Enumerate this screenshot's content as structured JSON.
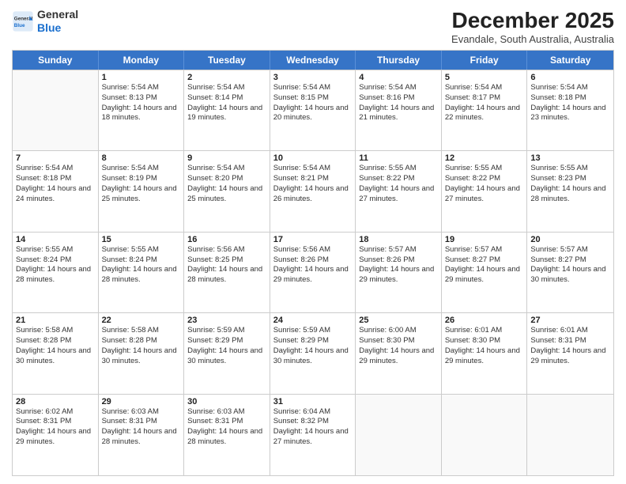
{
  "header": {
    "logo": {
      "general": "General",
      "blue": "Blue"
    },
    "title": "December 2025",
    "location": "Evandale, South Australia, Australia"
  },
  "weekdays": [
    "Sunday",
    "Monday",
    "Tuesday",
    "Wednesday",
    "Thursday",
    "Friday",
    "Saturday"
  ],
  "weeks": [
    [
      {
        "day": "",
        "sunrise": "",
        "sunset": "",
        "daylight": ""
      },
      {
        "day": "1",
        "sunrise": "Sunrise: 5:54 AM",
        "sunset": "Sunset: 8:13 PM",
        "daylight": "Daylight: 14 hours and 18 minutes."
      },
      {
        "day": "2",
        "sunrise": "Sunrise: 5:54 AM",
        "sunset": "Sunset: 8:14 PM",
        "daylight": "Daylight: 14 hours and 19 minutes."
      },
      {
        "day": "3",
        "sunrise": "Sunrise: 5:54 AM",
        "sunset": "Sunset: 8:15 PM",
        "daylight": "Daylight: 14 hours and 20 minutes."
      },
      {
        "day": "4",
        "sunrise": "Sunrise: 5:54 AM",
        "sunset": "Sunset: 8:16 PM",
        "daylight": "Daylight: 14 hours and 21 minutes."
      },
      {
        "day": "5",
        "sunrise": "Sunrise: 5:54 AM",
        "sunset": "Sunset: 8:17 PM",
        "daylight": "Daylight: 14 hours and 22 minutes."
      },
      {
        "day": "6",
        "sunrise": "Sunrise: 5:54 AM",
        "sunset": "Sunset: 8:18 PM",
        "daylight": "Daylight: 14 hours and 23 minutes."
      }
    ],
    [
      {
        "day": "7",
        "sunrise": "Sunrise: 5:54 AM",
        "sunset": "Sunset: 8:18 PM",
        "daylight": "Daylight: 14 hours and 24 minutes."
      },
      {
        "day": "8",
        "sunrise": "Sunrise: 5:54 AM",
        "sunset": "Sunset: 8:19 PM",
        "daylight": "Daylight: 14 hours and 25 minutes."
      },
      {
        "day": "9",
        "sunrise": "Sunrise: 5:54 AM",
        "sunset": "Sunset: 8:20 PM",
        "daylight": "Daylight: 14 hours and 25 minutes."
      },
      {
        "day": "10",
        "sunrise": "Sunrise: 5:54 AM",
        "sunset": "Sunset: 8:21 PM",
        "daylight": "Daylight: 14 hours and 26 minutes."
      },
      {
        "day": "11",
        "sunrise": "Sunrise: 5:55 AM",
        "sunset": "Sunset: 8:22 PM",
        "daylight": "Daylight: 14 hours and 27 minutes."
      },
      {
        "day": "12",
        "sunrise": "Sunrise: 5:55 AM",
        "sunset": "Sunset: 8:22 PM",
        "daylight": "Daylight: 14 hours and 27 minutes."
      },
      {
        "day": "13",
        "sunrise": "Sunrise: 5:55 AM",
        "sunset": "Sunset: 8:23 PM",
        "daylight": "Daylight: 14 hours and 28 minutes."
      }
    ],
    [
      {
        "day": "14",
        "sunrise": "Sunrise: 5:55 AM",
        "sunset": "Sunset: 8:24 PM",
        "daylight": "Daylight: 14 hours and 28 minutes."
      },
      {
        "day": "15",
        "sunrise": "Sunrise: 5:55 AM",
        "sunset": "Sunset: 8:24 PM",
        "daylight": "Daylight: 14 hours and 28 minutes."
      },
      {
        "day": "16",
        "sunrise": "Sunrise: 5:56 AM",
        "sunset": "Sunset: 8:25 PM",
        "daylight": "Daylight: 14 hours and 28 minutes."
      },
      {
        "day": "17",
        "sunrise": "Sunrise: 5:56 AM",
        "sunset": "Sunset: 8:26 PM",
        "daylight": "Daylight: 14 hours and 29 minutes."
      },
      {
        "day": "18",
        "sunrise": "Sunrise: 5:57 AM",
        "sunset": "Sunset: 8:26 PM",
        "daylight": "Daylight: 14 hours and 29 minutes."
      },
      {
        "day": "19",
        "sunrise": "Sunrise: 5:57 AM",
        "sunset": "Sunset: 8:27 PM",
        "daylight": "Daylight: 14 hours and 29 minutes."
      },
      {
        "day": "20",
        "sunrise": "Sunrise: 5:57 AM",
        "sunset": "Sunset: 8:27 PM",
        "daylight": "Daylight: 14 hours and 30 minutes."
      }
    ],
    [
      {
        "day": "21",
        "sunrise": "Sunrise: 5:58 AM",
        "sunset": "Sunset: 8:28 PM",
        "daylight": "Daylight: 14 hours and 30 minutes."
      },
      {
        "day": "22",
        "sunrise": "Sunrise: 5:58 AM",
        "sunset": "Sunset: 8:28 PM",
        "daylight": "Daylight: 14 hours and 30 minutes."
      },
      {
        "day": "23",
        "sunrise": "Sunrise: 5:59 AM",
        "sunset": "Sunset: 8:29 PM",
        "daylight": "Daylight: 14 hours and 30 minutes."
      },
      {
        "day": "24",
        "sunrise": "Sunrise: 5:59 AM",
        "sunset": "Sunset: 8:29 PM",
        "daylight": "Daylight: 14 hours and 30 minutes."
      },
      {
        "day": "25",
        "sunrise": "Sunrise: 6:00 AM",
        "sunset": "Sunset: 8:30 PM",
        "daylight": "Daylight: 14 hours and 29 minutes."
      },
      {
        "day": "26",
        "sunrise": "Sunrise: 6:01 AM",
        "sunset": "Sunset: 8:30 PM",
        "daylight": "Daylight: 14 hours and 29 minutes."
      },
      {
        "day": "27",
        "sunrise": "Sunrise: 6:01 AM",
        "sunset": "Sunset: 8:31 PM",
        "daylight": "Daylight: 14 hours and 29 minutes."
      }
    ],
    [
      {
        "day": "28",
        "sunrise": "Sunrise: 6:02 AM",
        "sunset": "Sunset: 8:31 PM",
        "daylight": "Daylight: 14 hours and 29 minutes."
      },
      {
        "day": "29",
        "sunrise": "Sunrise: 6:03 AM",
        "sunset": "Sunset: 8:31 PM",
        "daylight": "Daylight: 14 hours and 28 minutes."
      },
      {
        "day": "30",
        "sunrise": "Sunrise: 6:03 AM",
        "sunset": "Sunset: 8:31 PM",
        "daylight": "Daylight: 14 hours and 28 minutes."
      },
      {
        "day": "31",
        "sunrise": "Sunrise: 6:04 AM",
        "sunset": "Sunset: 8:32 PM",
        "daylight": "Daylight: 14 hours and 27 minutes."
      },
      {
        "day": "",
        "sunrise": "",
        "sunset": "",
        "daylight": ""
      },
      {
        "day": "",
        "sunrise": "",
        "sunset": "",
        "daylight": ""
      },
      {
        "day": "",
        "sunrise": "",
        "sunset": "",
        "daylight": ""
      }
    ]
  ]
}
